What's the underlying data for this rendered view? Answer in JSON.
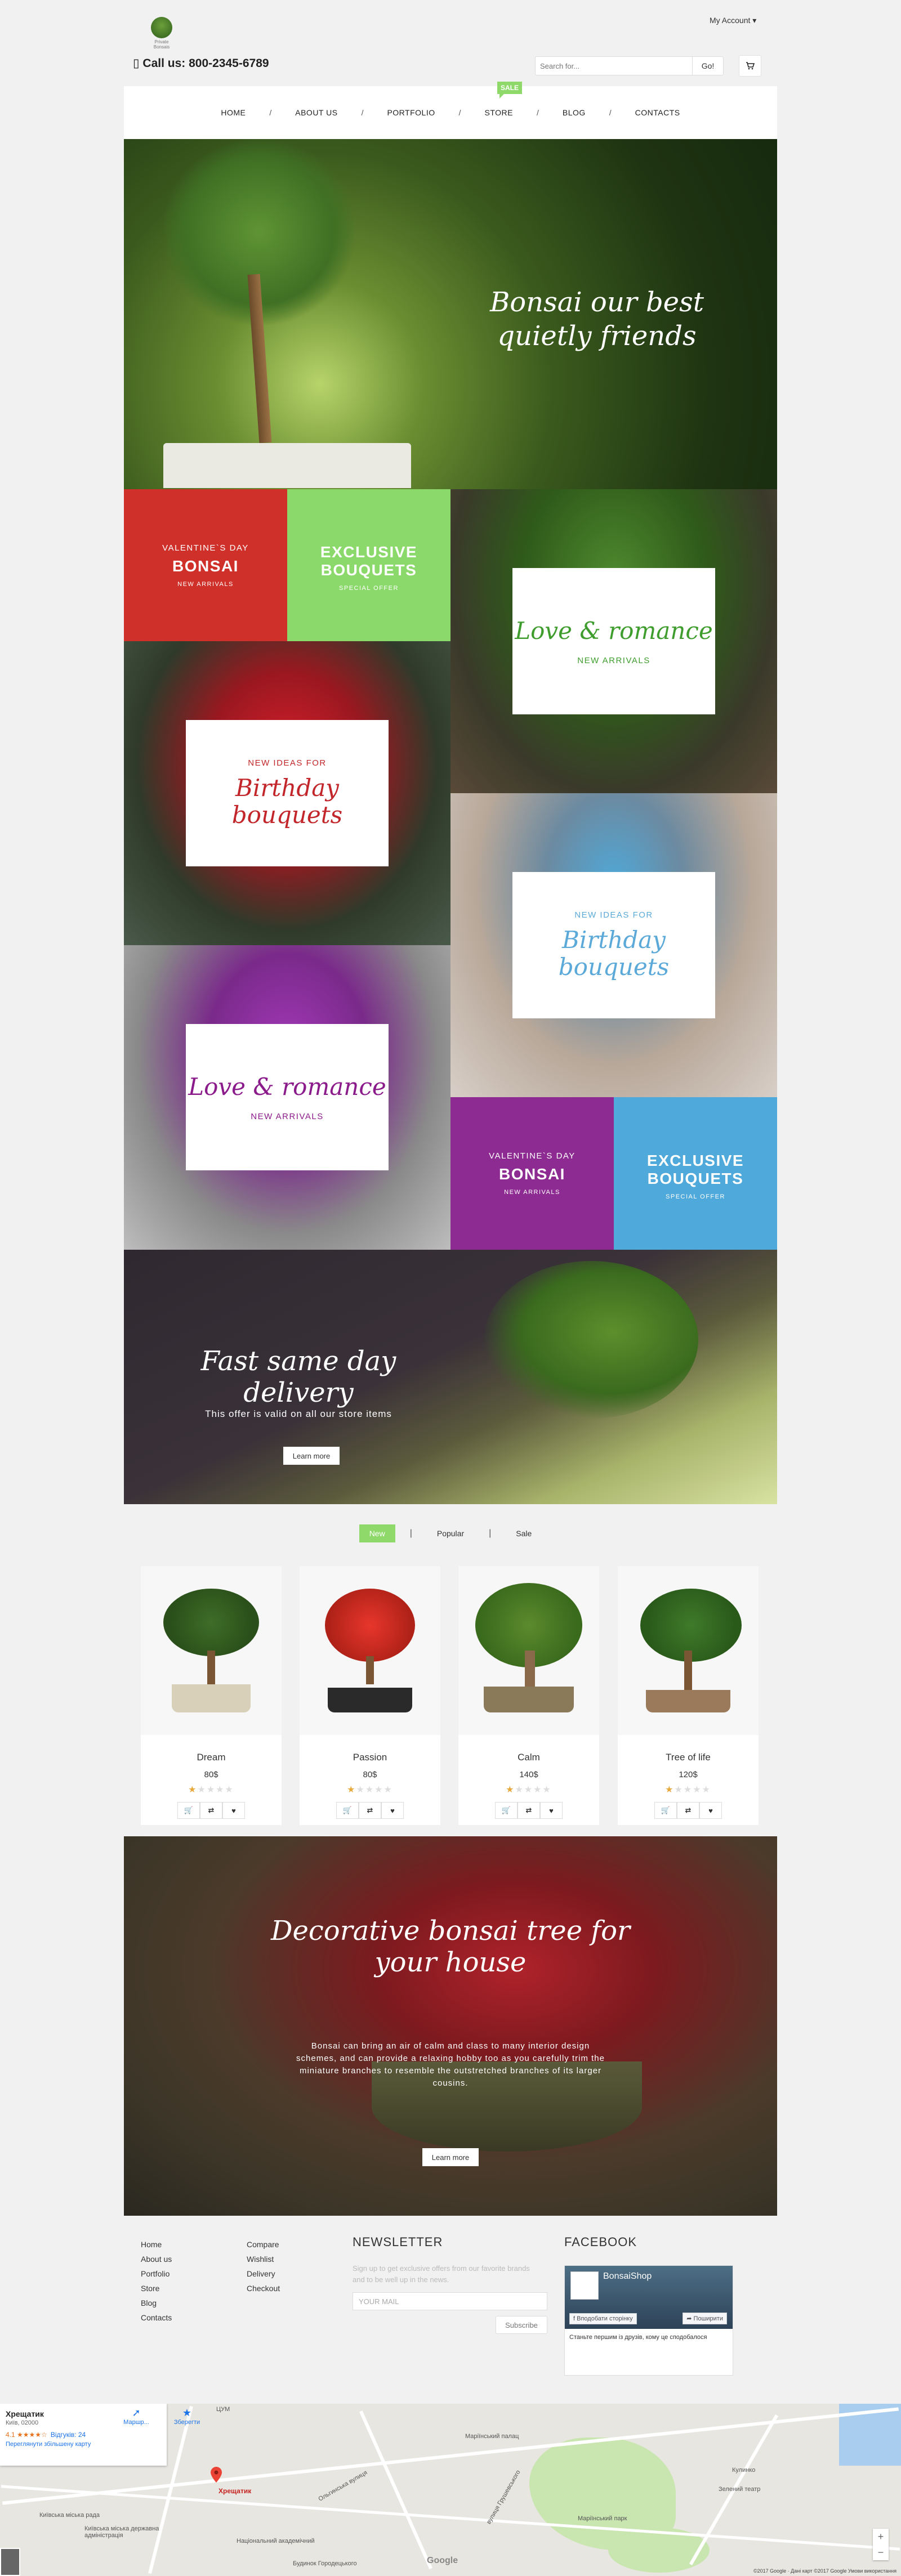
{
  "header": {
    "logo_text": "Private Bonsais",
    "account": "My Account ▾",
    "phone": "Call us: 800-2345-6789",
    "search_placeholder": "Search for...",
    "search_button": "Go!",
    "cart_icon": "cart-icon"
  },
  "nav": {
    "items": [
      "HOME",
      "ABOUT US",
      "PORTFOLIO",
      "STORE",
      "BLOG",
      "CONTACTS"
    ],
    "separator": "/",
    "sale_badge": "SALE"
  },
  "hero": {
    "title": "Bonsai our best quietly friends"
  },
  "tiles": {
    "red": {
      "kicker": "VALENTINE`S DAY",
      "big": "BONSAI",
      "small": "NEW ARRIVALS",
      "color": "#d0302a"
    },
    "green": {
      "big": "EXCLUSIVE BOUQUETS",
      "small": "SPECIAL OFFER",
      "color": "#8bd96b"
    },
    "love_green": {
      "title": "Love & romance",
      "sub": "NEW ARRIVALS",
      "color": "#3f9d2e"
    },
    "birthday_red": {
      "kicker": "NEW IDEAS FOR",
      "title": "Birthday bouquets",
      "color": "#c2262a"
    },
    "birthday_blue": {
      "kicker": "NEW IDEAS FOR",
      "title": "Birthday bouquets",
      "color": "#5aa9d8"
    },
    "love_purple": {
      "title": "Love & romance",
      "sub": "NEW ARRIVALS",
      "color": "#8b1a8b"
    },
    "purple": {
      "kicker": "VALENTINE`S DAY",
      "big": "BONSAI",
      "small": "NEW ARRIVALS",
      "color": "#8d2b92"
    },
    "blue": {
      "big": "EXCLUSIVE BOUQUETS",
      "small": "SPECIAL OFFER",
      "color": "#4fa9db"
    }
  },
  "delivery": {
    "title": "Fast same day delivery",
    "text": "This offer is valid on all our store items",
    "button": "Learn more"
  },
  "tabs": {
    "items": [
      "New",
      "Popular",
      "Sale"
    ],
    "separator": "|",
    "active": "New",
    "accent": "#8ed96a"
  },
  "products": [
    {
      "name": "Dream",
      "price": "80$",
      "rating": 1,
      "max": 5
    },
    {
      "name": "Passion",
      "price": "80$",
      "rating": 1,
      "max": 5
    },
    {
      "name": "Calm",
      "price": "140$",
      "rating": 1,
      "max": 5
    },
    {
      "name": "Tree of life",
      "price": "120$",
      "rating": 1,
      "max": 5
    }
  ],
  "decorative": {
    "title": "Decorative bonsai tree for your house",
    "text": "Bonsai can bring an air of calm and class to many interior design schemes, and can provide a relaxing hobby too as you carefully trim the miniature branches to resemble the outstretched branches of its larger cousins.",
    "button": "Learn more"
  },
  "footer": {
    "col1": [
      "Home",
      "About us",
      "Portfolio",
      "Store",
      "Blog",
      "Contacts"
    ],
    "col2": [
      "Compare",
      "Wishlist",
      "Delivery",
      "Checkout"
    ],
    "newsletter_title": "NEWSLETTER",
    "newsletter_text": "Sign up to get exclusive offers from our favorite brands and to be well up in the news.",
    "mail_placeholder": "YOUR MAIL",
    "subscribe": "Subscribe",
    "facebook_title": "FACEBOOK",
    "fb_page": "BonsaiShop",
    "fb_like": "Вподобати сторінку",
    "fb_share": "Поширити",
    "fb_desc": "Станьте першим із друзів, кому це сподобалося"
  },
  "map": {
    "place_name": "Хрещатик",
    "place_addr": "Київ, 02000",
    "rating": "4.1 ★★★★☆",
    "reviews": "Відгуків: 24",
    "bigger_map": "Переглянути збільшену карту",
    "route": "Маршр...",
    "save": "Зберегти",
    "pin_label": "Хрещатик",
    "labels": [
      "Маріїнський палац",
      "Кулинко",
      "Зелений театр",
      "Маріїнський парк",
      "Національний академічний",
      "Київська міська рада",
      "Київська міська державна адміністрація",
      "Будинок Городецького",
      "ЦУМ",
      "Ольгинська вулиця",
      "вулиця Грушевського"
    ],
    "footer_text": "©2017 Google · Дані карт ©2017 Google   Умови використання",
    "google": "Google"
  }
}
